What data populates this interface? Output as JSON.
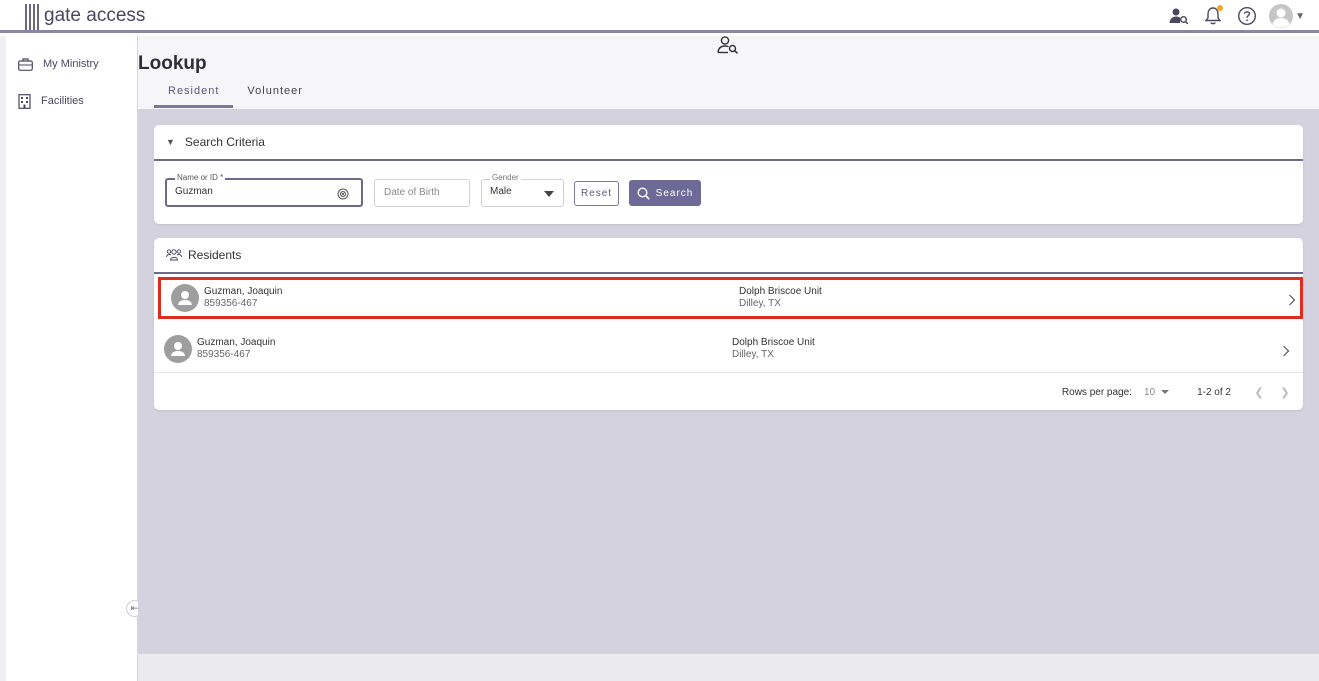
{
  "app": {
    "logo_text": "gate access"
  },
  "topbar": {
    "icons": [
      "person-search-icon",
      "bell-icon",
      "help-icon",
      "avatar"
    ]
  },
  "sidebar": {
    "items": [
      {
        "label": "My Ministry",
        "icon": "briefcase-icon"
      },
      {
        "label": "Facilities",
        "icon": "building-icon"
      }
    ]
  },
  "page": {
    "title": "Lookup",
    "tabs": [
      {
        "label": "Resident",
        "active": true
      },
      {
        "label": "Volunteer",
        "active": false
      }
    ]
  },
  "criteria": {
    "title": "Search Criteria",
    "name_label": "Name or ID *",
    "name_value": "Guzman",
    "dob_placeholder": "Date of Birth",
    "gender_label": "Gender",
    "gender_value": "Male",
    "reset_label": "Reset",
    "search_label": "Search"
  },
  "residents": {
    "title": "Residents",
    "rows": [
      {
        "name": "Guzman, Joaquin",
        "id": "859356-467",
        "unit": "Dolph Briscoe Unit",
        "city": "Dilley, TX",
        "selected": true
      },
      {
        "name": "Guzman, Joaquin",
        "id": "859356-467",
        "unit": "Dolph Briscoe Unit",
        "city": "Dilley, TX",
        "selected": false
      }
    ],
    "pager": {
      "rows_per_page_label": "Rows per page:",
      "rows_per_page": "10",
      "range": "1-2 of 2"
    }
  },
  "colors": {
    "accent": "#6e6a98",
    "selection": "#e02b20",
    "notification": "#f5a623"
  }
}
